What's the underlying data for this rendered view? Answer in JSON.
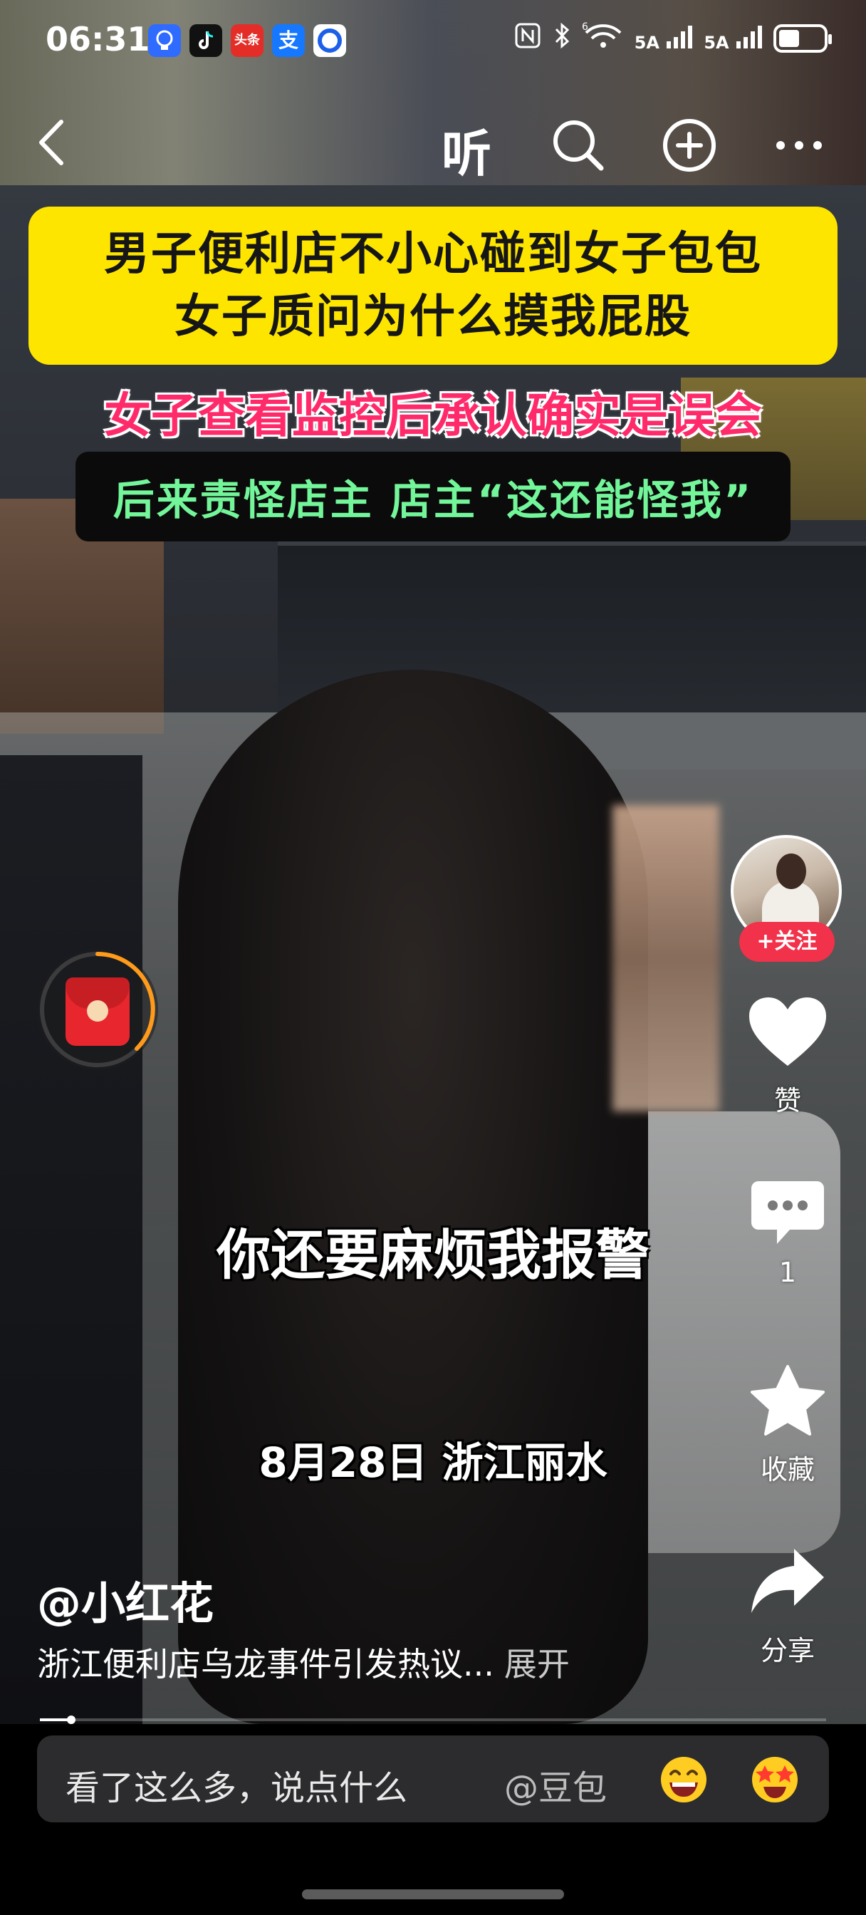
{
  "status_bar": {
    "time": "06:31",
    "apps": [
      {
        "icon": "bulb-icon",
        "bg": "#2f6bff"
      },
      {
        "icon": "tiktok-icon",
        "bg": "#111111"
      },
      {
        "icon": "toutiao-icon",
        "label": "头条",
        "bg": "#e52d27"
      },
      {
        "icon": "alipay-icon",
        "label": "支",
        "bg": "#1677ff"
      },
      {
        "icon": "browser-icon",
        "bg": "#ffffff"
      }
    ],
    "signal_a": "5A",
    "signal_b": "5A",
    "wifi_label": "6"
  },
  "nav": {
    "listen_label": "听"
  },
  "captions": {
    "yellow_line1": "男子便利店不小心碰到女子包包",
    "yellow_line2": "女子质问为什么摸我屁股",
    "pink_line": "女子查看监控后承认确实是误会",
    "black_line": "后来责怪店主 店主“这还能怪我”",
    "subtitle": "你还要麻烦我报警",
    "date_location": "8月28日 浙江丽水"
  },
  "rail": {
    "follow_label": "+关注",
    "like_label": "赞",
    "comment_count": "1",
    "favorite_label": "收藏",
    "share_label": "分享"
  },
  "video": {
    "author": "@小红花",
    "description": "浙江便利店乌龙事件引发热议...",
    "expand_label": "展开",
    "progress_percent": 4
  },
  "comment_bar": {
    "placeholder": "看了这么多，说点什么",
    "mention": "@豆包"
  },
  "colors": {
    "caption_yellow": "#fde500",
    "caption_pink": "#ff2a6a",
    "caption_green": "#73f59a",
    "follow_red": "#f2314a"
  }
}
